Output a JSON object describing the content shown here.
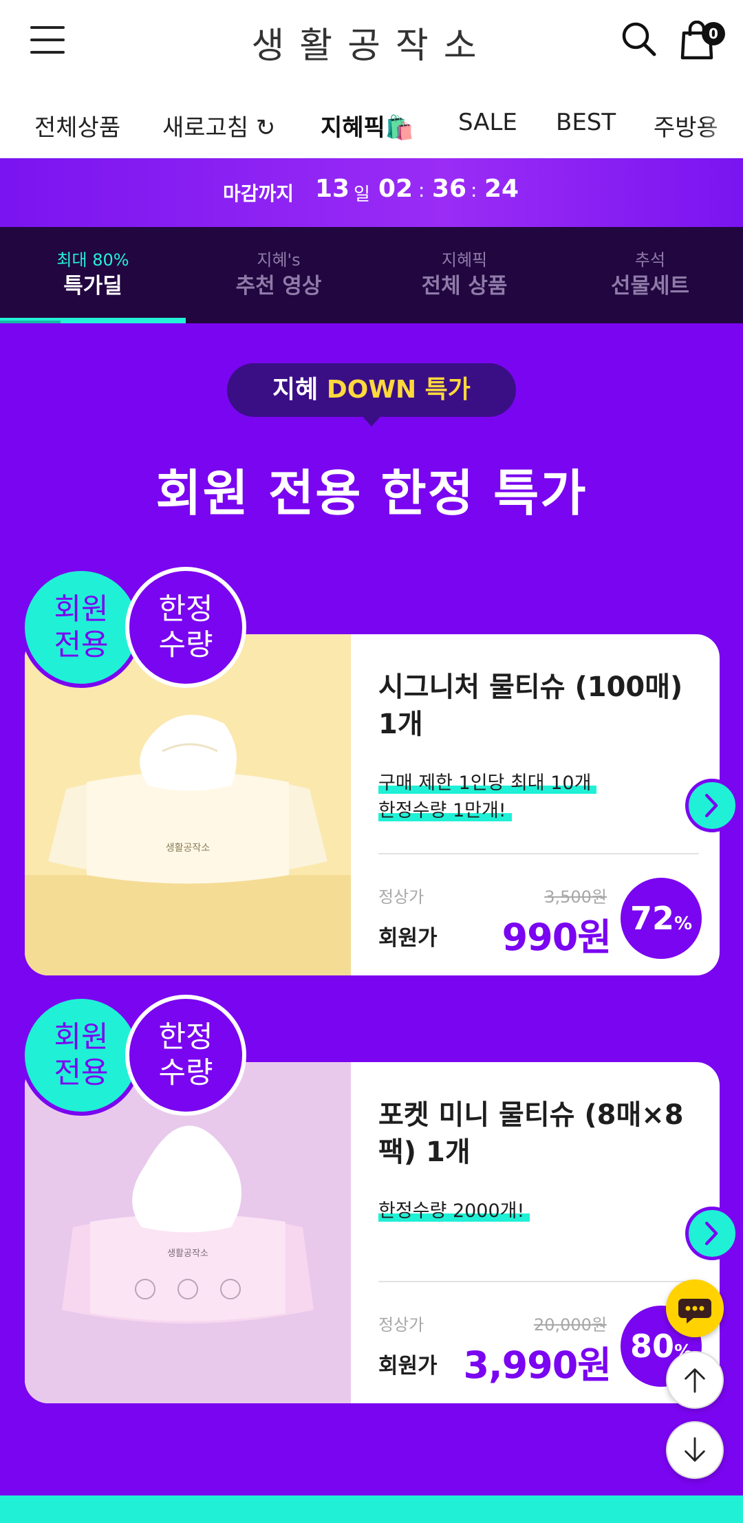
{
  "header": {
    "logo": "생활공작소",
    "cart_count": "0"
  },
  "nav": {
    "items": [
      {
        "label": "전체상품"
      },
      {
        "label": "새로고침 ↻"
      },
      {
        "label": "지혜픽🛍️"
      },
      {
        "label": "SALE"
      },
      {
        "label": "BEST"
      },
      {
        "label": "주방용"
      }
    ]
  },
  "countdown": {
    "label": "마감까지",
    "days": "13",
    "day_unit": "일",
    "hours": "02",
    "minutes": "36",
    "seconds": "24"
  },
  "tabs": [
    {
      "sub": "최대 80%",
      "main": "특가딜",
      "active": true
    },
    {
      "sub": "지혜's",
      "main": "추천 영상",
      "active": false
    },
    {
      "sub": "지혜픽",
      "main": "전체 상품",
      "active": false
    },
    {
      "sub": "추석",
      "main": "선물세트",
      "active": false
    }
  ],
  "section": {
    "pill_prefix": "지혜 ",
    "pill_accent": "DOWN 특가",
    "title": "회원 전용 한정 특가"
  },
  "badges": {
    "member": [
      "회원",
      "전용"
    ],
    "limited": [
      "한정",
      "수량"
    ]
  },
  "products": [
    {
      "title": "시그니처 물티슈 (100매) 1개",
      "notes": [
        "구매 제한 1인당 최대 10개",
        "한정수량 1만개!"
      ],
      "regular_label": "정상가",
      "regular_price": "3,500원",
      "member_label": "회원가",
      "member_price": "990원",
      "discount": "72",
      "discount_unit": "%",
      "package_text": "생활공작소"
    },
    {
      "title": "포켓 미니 물티슈 (8매×8팩) 1개",
      "notes": [
        "한정수량 2000개!"
      ],
      "regular_label": "정상가",
      "regular_price": "20,000원",
      "member_label": "회원가",
      "member_price": "3,990원",
      "discount": "80",
      "discount_unit": "%",
      "package_text": "생활공작소"
    }
  ],
  "colors": {
    "primary_purple": "#7a05f0",
    "mint": "#20f0d6",
    "dark_tab_bg": "#220640",
    "accent_yellow": "#ffd93b",
    "chat_yellow": "#ffd200"
  },
  "icons": [
    "menu-icon",
    "search-icon",
    "shopping-bag-icon",
    "chevron-right-icon",
    "chat-icon",
    "arrow-up-icon",
    "arrow-down-icon"
  ]
}
